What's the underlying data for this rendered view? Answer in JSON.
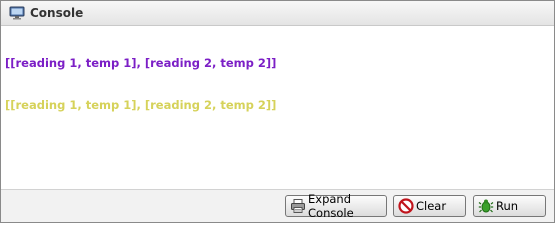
{
  "window": {
    "title": "Console",
    "icon": "monitor-icon"
  },
  "console": {
    "lines": [
      {
        "text": "[[reading 1, temp 1], [reading 2, temp 2]]",
        "color": "#7c1fc6"
      },
      {
        "text": "[[reading 1, temp 1], [reading 2, temp 2]]",
        "color": "#d6d25a"
      }
    ]
  },
  "toolbar": {
    "expand_label": "Expand Console",
    "expand_icon": "printer-icon",
    "clear_label": "Clear",
    "clear_icon": "no-entry-icon",
    "run_label": "Run",
    "run_icon": "bug-icon"
  }
}
